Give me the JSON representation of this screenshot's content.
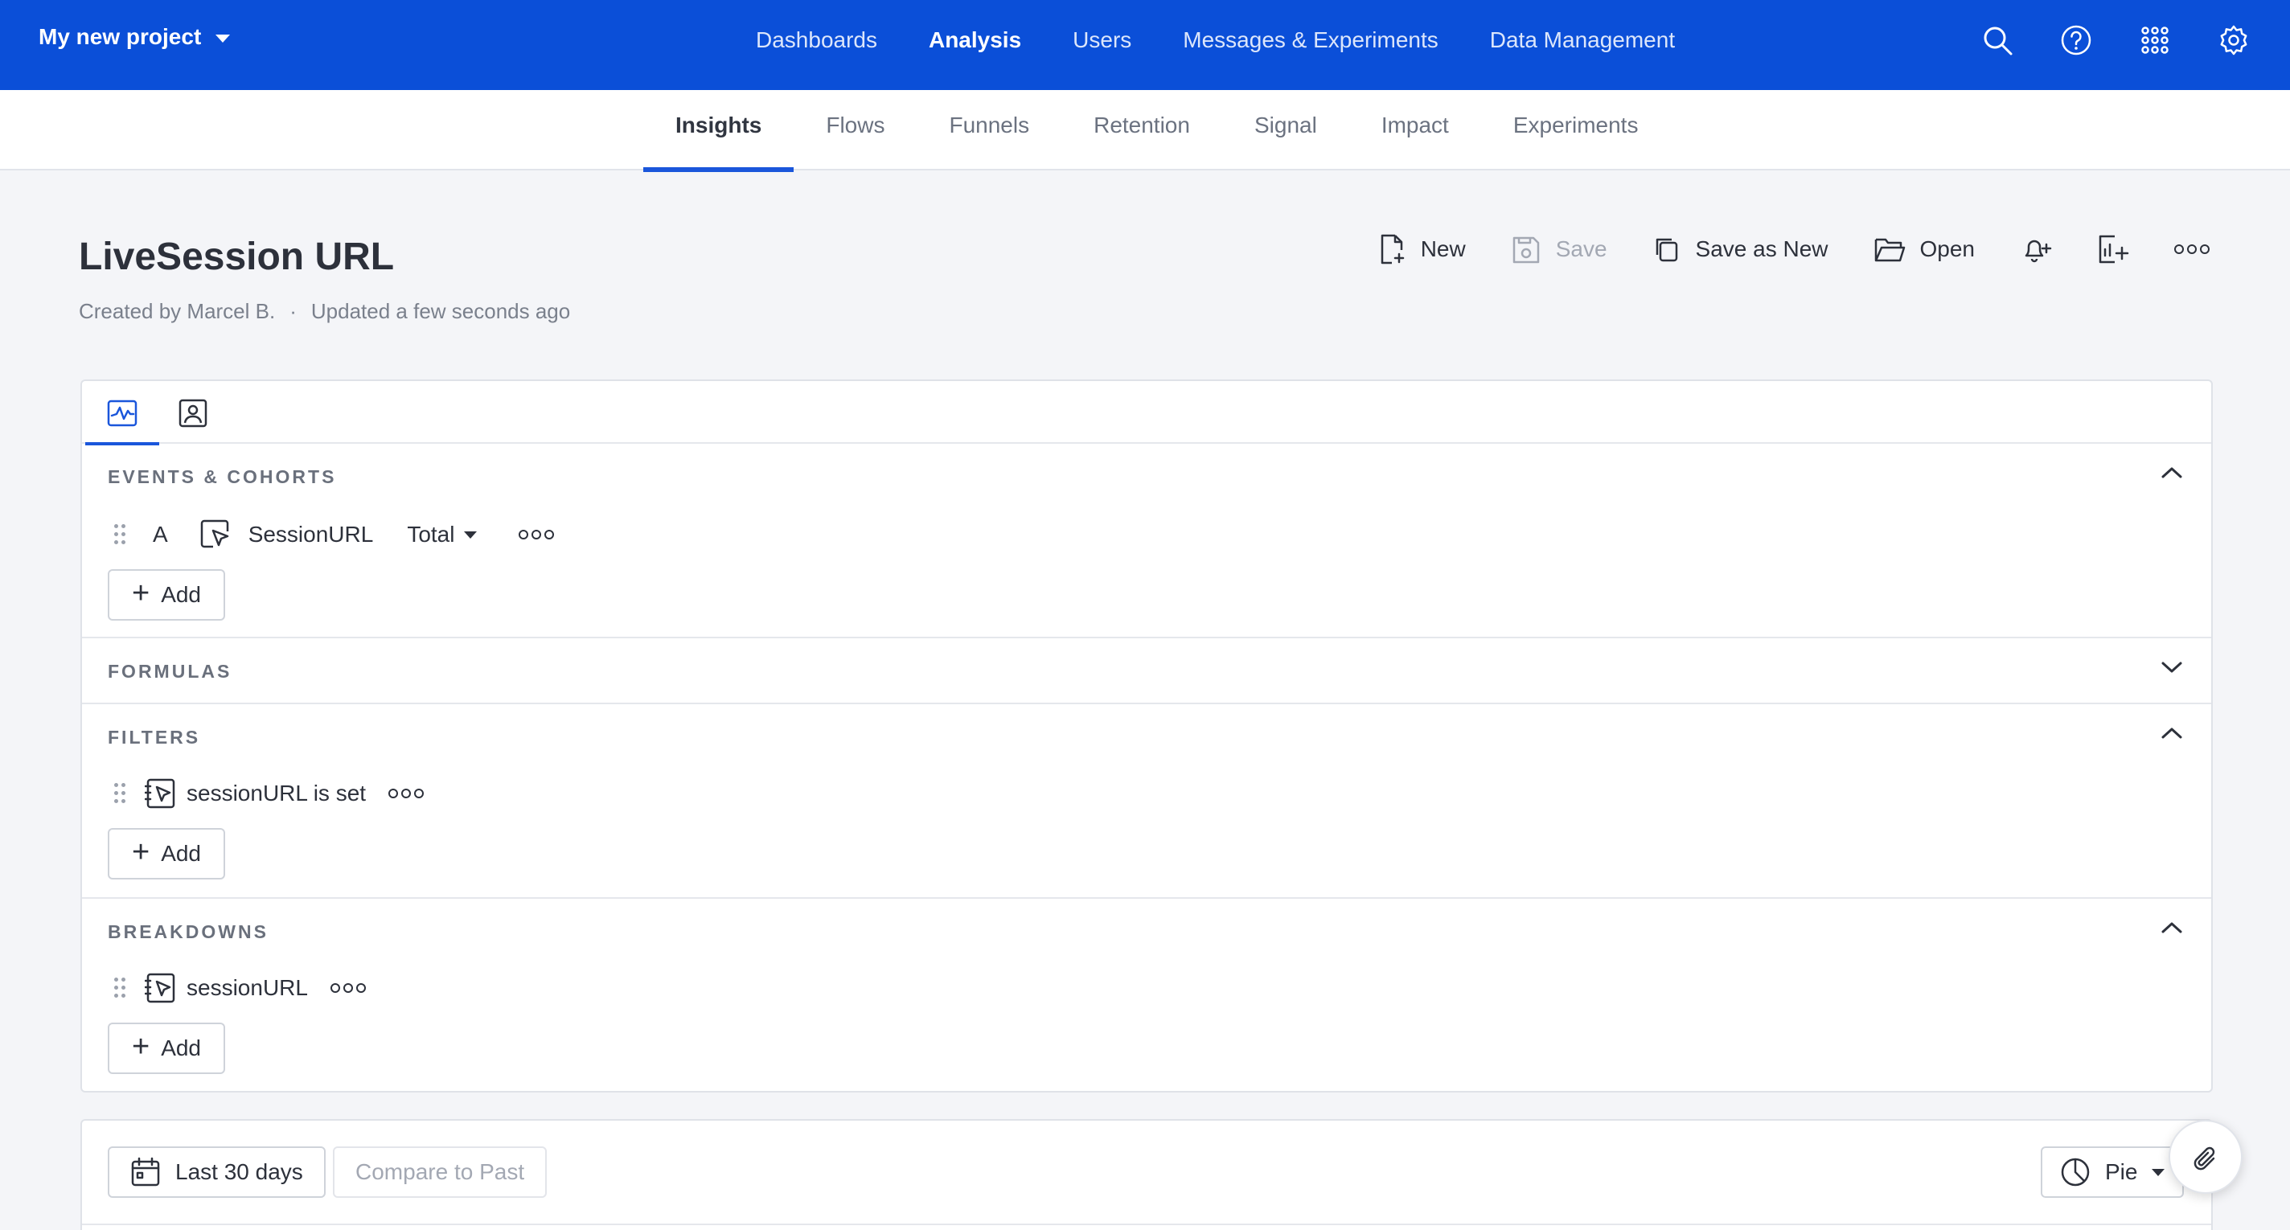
{
  "topbar": {
    "project_name": "My new project",
    "nav": [
      {
        "label": "Dashboards",
        "active": false
      },
      {
        "label": "Analysis",
        "active": true
      },
      {
        "label": "Users",
        "active": false
      },
      {
        "label": "Messages & Experiments",
        "active": false
      },
      {
        "label": "Data Management",
        "active": false
      }
    ],
    "icons": [
      "search-icon",
      "help-icon",
      "apps-grid-icon",
      "settings-gear-icon"
    ],
    "background": "#0b4fd8"
  },
  "subnav": {
    "tabs": [
      "Insights",
      "Flows",
      "Funnels",
      "Retention",
      "Signal",
      "Impact",
      "Experiments"
    ],
    "active": "Insights"
  },
  "report": {
    "title": "LiveSession URL",
    "created_by": "Created by Marcel B.",
    "separator": "·",
    "updated": "Updated a few seconds ago"
  },
  "actions": {
    "new": "New",
    "save": "Save",
    "save_as_new": "Save as New",
    "open": "Open"
  },
  "panel": {
    "tabs": [
      "chart-icon",
      "user-profile-icon"
    ],
    "events": {
      "heading": "EVENTS & COHORTS",
      "item": {
        "letter": "A",
        "name": "SessionURL",
        "aggregation": "Total"
      },
      "add": "Add"
    },
    "formulas": {
      "heading": "FORMULAS"
    },
    "filters": {
      "heading": "FILTERS",
      "item": "sessionURL is set",
      "add": "Add"
    },
    "breakdowns": {
      "heading": "BREAKDOWNS",
      "item": "sessionURL",
      "add": "Add"
    }
  },
  "controls": {
    "date_range": "Last 30 days",
    "compare": "Compare to Past",
    "chart_type": "Pie"
  },
  "accent": "#1a56db"
}
